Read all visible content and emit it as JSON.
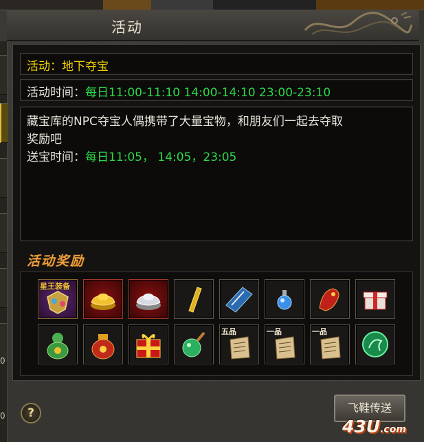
{
  "window": {
    "title": "活动"
  },
  "event": {
    "name_label": "活动：",
    "name": "地下夺宝",
    "time_label": "活动时间：",
    "time_value": "每日11:00-11:10 14:00-14:10 23:00-23:10",
    "description_line1": "藏宝库的NPC夺宝人偶携带了大量宝物，和朋友们一起去夺取",
    "description_line2": "奖励吧",
    "delivery_label": "送宝时间：",
    "delivery_value": "每日11:05， 14:05，23:05"
  },
  "rewards": {
    "header": "活动奖励",
    "row1": [
      {
        "icon": "star-king-equipment-icon",
        "tag": "星王装备"
      },
      {
        "icon": "gold-ingot-icon"
      },
      {
        "icon": "silver-ingot-icon"
      },
      {
        "icon": "gold-bar-icon"
      },
      {
        "icon": "blue-book-icon"
      },
      {
        "icon": "blue-potion-icon"
      },
      {
        "icon": "red-dragon-item-icon"
      },
      {
        "icon": "gift-box-icon"
      }
    ],
    "row2": [
      {
        "icon": "lucky-gourd-bag-icon"
      },
      {
        "icon": "red-treasure-bag-icon"
      },
      {
        "icon": "red-gift-box-icon"
      },
      {
        "icon": "green-potion-flask-icon"
      },
      {
        "icon": "scroll-icon",
        "tag": "五品"
      },
      {
        "icon": "scroll-icon",
        "tag": "一品"
      },
      {
        "icon": "scroll-icon",
        "tag": "一品"
      },
      {
        "icon": "green-jade-orb-icon"
      }
    ]
  },
  "buttons": {
    "teleport": "飞鞋传送",
    "help": "?"
  },
  "watermark": {
    "text": "43U",
    "suffix": ".com"
  },
  "edge_labels": {
    "a": "0",
    "b": "0"
  },
  "colors": {
    "yellow": "#f0d000",
    "green": "#2ed84a",
    "orange": "#e8a040"
  }
}
